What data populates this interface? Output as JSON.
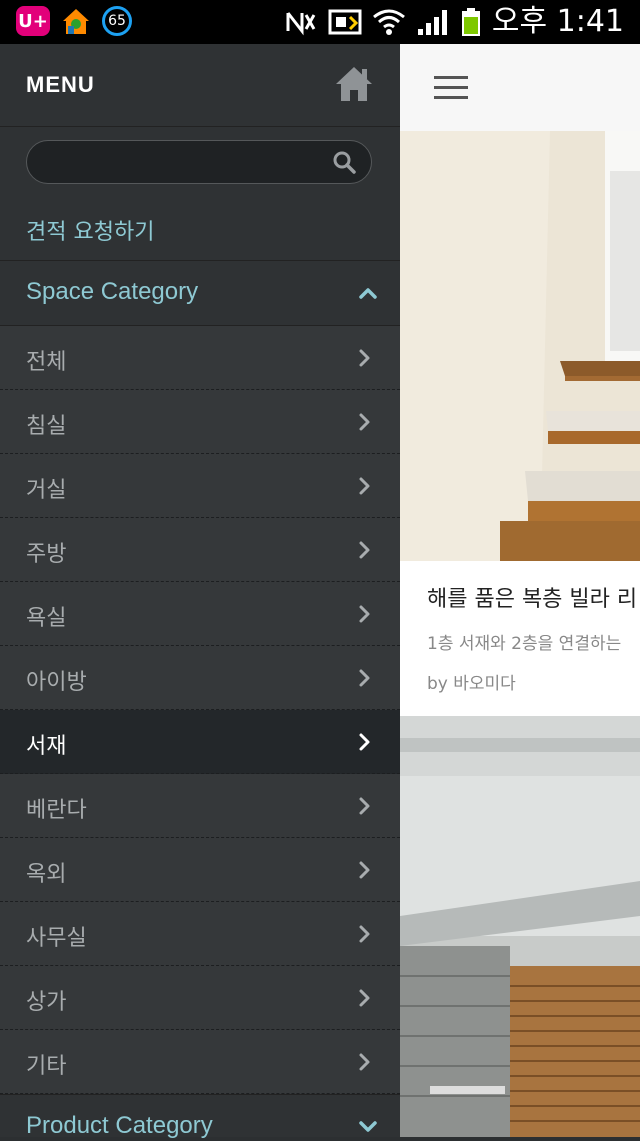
{
  "status_bar": {
    "carrier_label": "U+",
    "badge_count": "65",
    "time": "오후 1:41"
  },
  "sidebar": {
    "title": "MENU",
    "search": {
      "value": "",
      "placeholder": ""
    },
    "quote_link": "견적 요청하기",
    "space_category": {
      "label": "Space Category",
      "expanded": true,
      "items": [
        {
          "label": "전체",
          "active": false
        },
        {
          "label": "침실",
          "active": false
        },
        {
          "label": "거실",
          "active": false
        },
        {
          "label": "주방",
          "active": false
        },
        {
          "label": "욕실",
          "active": false
        },
        {
          "label": "아이방",
          "active": false
        },
        {
          "label": "서재",
          "active": true
        },
        {
          "label": "베란다",
          "active": false
        },
        {
          "label": "옥외",
          "active": false
        },
        {
          "label": "사무실",
          "active": false
        },
        {
          "label": "상가",
          "active": false
        },
        {
          "label": "기타",
          "active": false
        }
      ]
    },
    "product_category": {
      "label": "Product Category",
      "expanded": false
    }
  },
  "content": {
    "card": {
      "title": "해를 품은 복층 빌라 리",
      "description": "1층 서재와 2층을 연결하는",
      "author": "by 바오미다"
    }
  },
  "colors": {
    "sidebar_bg": "#2f3234",
    "accent_teal": "#8ec9d3",
    "active_item_bg": "#23272a"
  }
}
